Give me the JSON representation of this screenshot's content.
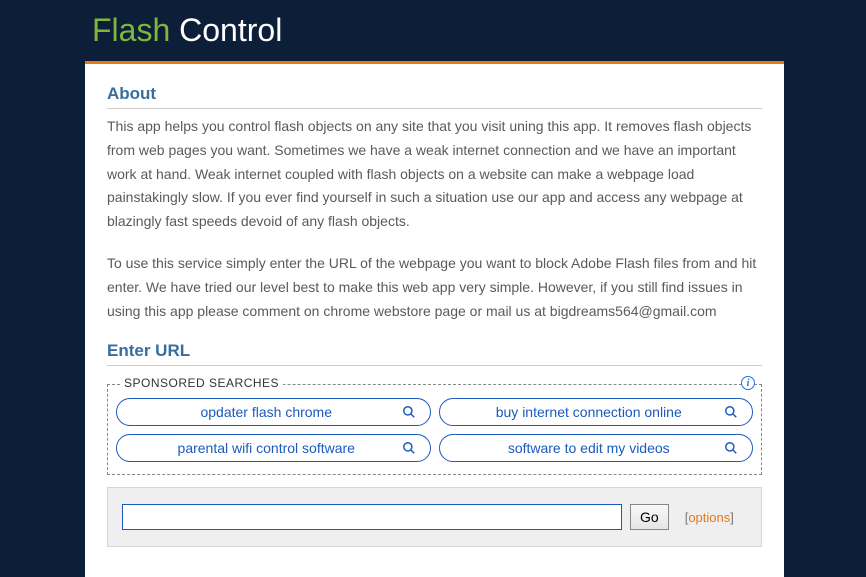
{
  "logo": {
    "part1": "Flash",
    "part2": "Control"
  },
  "about": {
    "heading": "About",
    "para1": "This app helps you control flash objects on any site that you visit uning this app. It removes flash objects from web pages you want. Sometimes we have a weak internet connection and we have an important work at hand. Weak internet coupled with flash objects on a website can make a webpage load painstakingly slow. If you ever find yourself in such a situation use our app and access any webpage at blazingly fast speeds devoid of any flash objects.",
    "para2": "To use this service simply enter the URL of the webpage you want to block Adobe Flash files from and hit enter. We have tried our level best to make this web app very simple. However, if you still find issues in using this app please comment on chrome webstore page or mail us at bigdreams564@gmail.com"
  },
  "url_section": {
    "heading": "Enter URL",
    "go_label": "Go",
    "options_label": "options"
  },
  "sponsored": {
    "label": "SPONSORED SEARCHES",
    "items": [
      {
        "label": "opdater flash chrome"
      },
      {
        "label": "buy internet connection online"
      },
      {
        "label": "parental wifi control software"
      },
      {
        "label": "software to edit my videos"
      }
    ]
  },
  "colors": {
    "accent_green": "#7db83a",
    "accent_orange": "#e67817",
    "link_blue": "#1a5abf",
    "heading_blue": "#376e9c",
    "bg_dark": "#0d1e38"
  }
}
